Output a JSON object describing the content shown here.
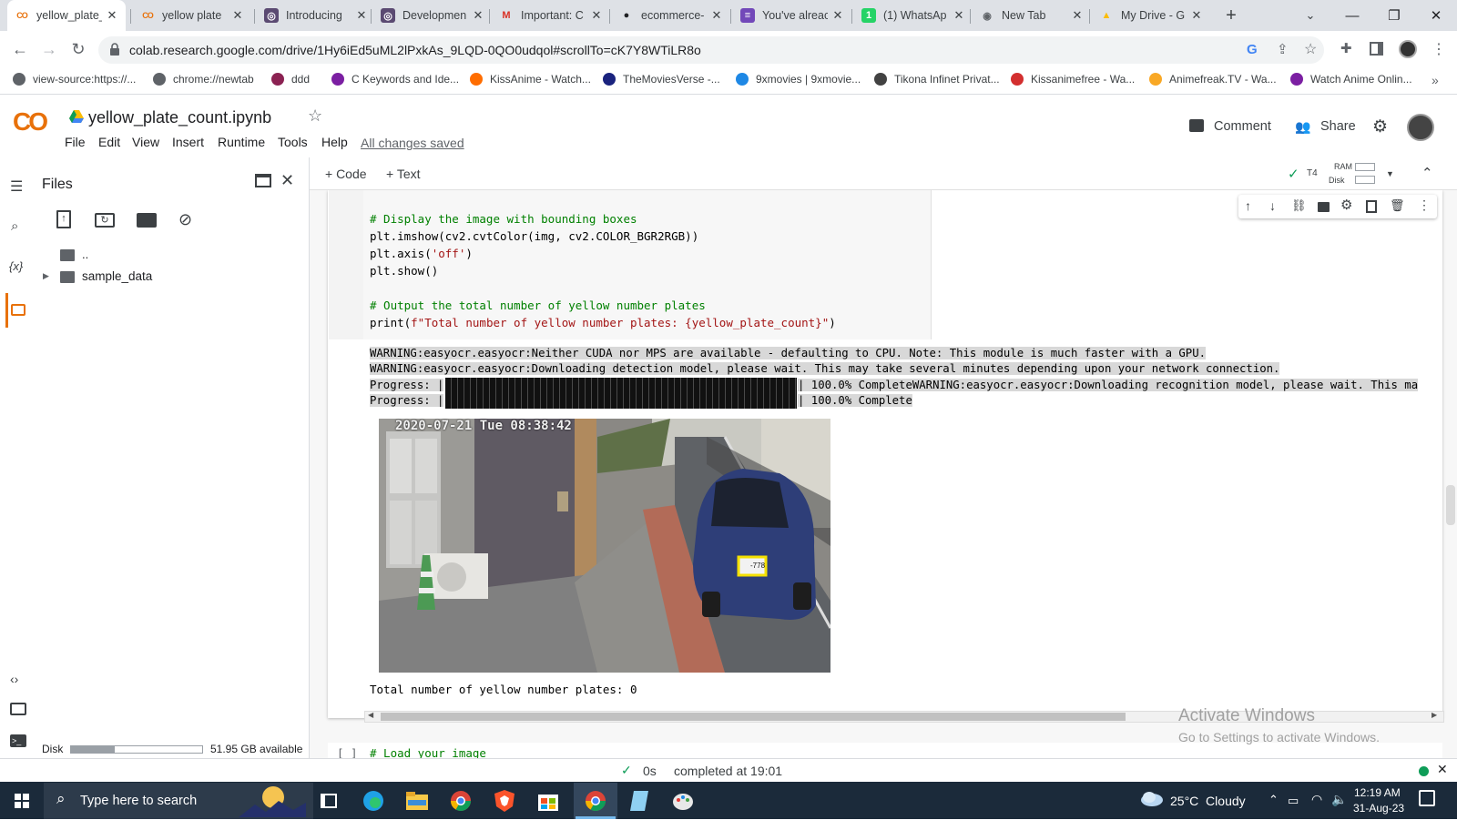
{
  "tabs": [
    {
      "title": "yellow_plate_",
      "icon": "colab-icon"
    },
    {
      "title": "yellow plate",
      "icon": "colab-icon"
    },
    {
      "title": "Introducing",
      "icon": "openai-icon"
    },
    {
      "title": "Developmen",
      "icon": "openai-icon"
    },
    {
      "title": "Important: C",
      "icon": "gmail-icon"
    },
    {
      "title": "ecommerce-",
      "icon": "github-icon"
    },
    {
      "title": "You've alreac",
      "icon": "forms-icon"
    },
    {
      "title": "(1) WhatsAp",
      "icon": "whatsapp-icon"
    },
    {
      "title": "New Tab",
      "icon": "chrome-icon"
    },
    {
      "title": "My Drive - G",
      "icon": "drive-icon"
    }
  ],
  "address_bar": {
    "url": "colab.research.google.com/drive/1Hy6iEd5uML2lPxkAs_9LQD-0QO0udqol#scrollTo=cK7Y8WTiLR8o"
  },
  "bookmarks": [
    "view-source:https://...",
    "chrome://newtab",
    "ddd",
    "C Keywords and Ide...",
    "KissAnime - Watch...",
    "TheMoviesVerse -...",
    "9xmovies | 9xmovie...",
    "Tikona Infinet Privat...",
    "Kissanimefree - Wa...",
    "Animefreak.TV - Wa...",
    "Watch Anime Onlin..."
  ],
  "colab": {
    "logo": "CO",
    "notebook_title": "yellow_plate_count.ipynb",
    "menu": [
      "File",
      "Edit",
      "View",
      "Insert",
      "Runtime",
      "Tools",
      "Help"
    ],
    "save_status": "All changes saved",
    "comment_label": "Comment",
    "share_label": "Share"
  },
  "files_panel": {
    "title": "Files",
    "parent_dir": "..",
    "folder": "sample_data",
    "disk_label": "Disk",
    "disk_available": "51.95 GB available",
    "disk_used_fraction": 0.33
  },
  "toolbar": {
    "code_label": "+ Code",
    "text_label": "+ Text",
    "runtime_type": "T4",
    "ram_label": "RAM",
    "disk_label": "Disk"
  },
  "code_cell": {
    "lines": [
      {
        "pre": "# Display the image with bounding boxes",
        "kind": "comment"
      },
      {
        "pre": "plt.imshow(cv2.cvtColor(img, cv2.COLOR_BGR2RGB))",
        "kind": "code"
      },
      {
        "pre": "plt.axis(",
        "str": "'off'",
        "post": ")",
        "kind": "mixed"
      },
      {
        "pre": "plt.show()",
        "kind": "code"
      },
      {
        "pre": "",
        "kind": "blank"
      },
      {
        "pre": "# Output the total number of yellow number plates",
        "kind": "comment"
      },
      {
        "pre": "print(",
        "str": "f\"Total number of yellow number plates: {yellow_plate_count}\"",
        "post": ")",
        "kind": "mixed"
      }
    ]
  },
  "output": {
    "log_lines": [
      "WARNING:easyocr.easyocr:Neither CUDA nor MPS are available - defaulting to CPU. Note: This module is much faster with a GPU.",
      "WARNING:easyocr.easyocr:Downloading detection model, please wait. This may take several minutes depending upon your network connection."
    ],
    "progress_rows": [
      {
        "label": "Progress: |",
        "tail": "| 100.0% CompleteWARNING:easyocr.easyocr:Downloading recognition model, please wait. This ma",
        "fraction": 1.0
      },
      {
        "label": "Progress: |",
        "tail": "| 100.0% Complete",
        "fraction": 1.0
      }
    ],
    "image_timestamp": "2020-07-21 Tue 08:38:42",
    "plate_text": "-778",
    "result_text": "Total number of yellow number plates: 0"
  },
  "next_cell": {
    "bracket": "[ ]",
    "code": "# Load your image"
  },
  "watermark": {
    "line1": "Activate Windows",
    "line2": "Go to Settings to activate Windows."
  },
  "statusbar": {
    "duration": "0s",
    "completed": "completed at 19:01"
  },
  "taskbar": {
    "search_placeholder": "Type here to search",
    "weather": "25°C  Cloudy",
    "time": "12:19 AM",
    "date": "31-Aug-23"
  },
  "colors": {
    "accent": "#f9ab00",
    "colab_orange": "#e8710a",
    "tab_bg": "#dee1e6",
    "taskbar": "#1b2a3a"
  }
}
